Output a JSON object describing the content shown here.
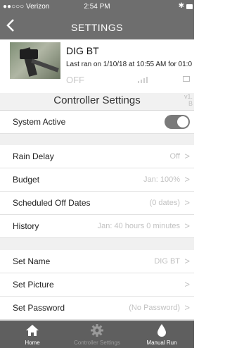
{
  "status_bar": {
    "carrier": "●●○○○ Verizon",
    "time": "2:54 PM",
    "bluetooth": "✱"
  },
  "nav": {
    "back_icon": "chevron-left-icon",
    "title": "SETTINGS"
  },
  "device": {
    "name": "DIG BT",
    "last_run": "Last ran on 1/10/18 at 10:55 AM for 01:0",
    "state": "OFF"
  },
  "section": {
    "title": "Controller Settings",
    "version": "v1.\nB"
  },
  "rows": {
    "system_active": {
      "label": "System Active",
      "toggle_on": true
    },
    "rain_delay": {
      "label": "Rain Delay",
      "value": "Off"
    },
    "budget": {
      "label": "Budget",
      "value": "Jan: 100%"
    },
    "scheduled_off": {
      "label": "Scheduled Off Dates",
      "value": "(0 dates)"
    },
    "history": {
      "label": "History",
      "value": "Jan: 40 hours 0 minutes"
    },
    "set_name": {
      "label": "Set Name",
      "value": "DIG BT"
    },
    "set_picture": {
      "label": "Set Picture",
      "value": ""
    },
    "set_password": {
      "label": "Set Password",
      "value": "(No Password)"
    }
  },
  "chevron": ">",
  "tabs": [
    {
      "label": "Home",
      "icon": "home-icon"
    },
    {
      "label": "Controller Settings",
      "icon": "gear-icon"
    },
    {
      "label": "Manual Run",
      "icon": "water-drop-icon"
    }
  ],
  "colors": {
    "bar": "#6e6e6e",
    "tabbar": "#5f5f5f",
    "toggle": "#7a7a7a"
  }
}
